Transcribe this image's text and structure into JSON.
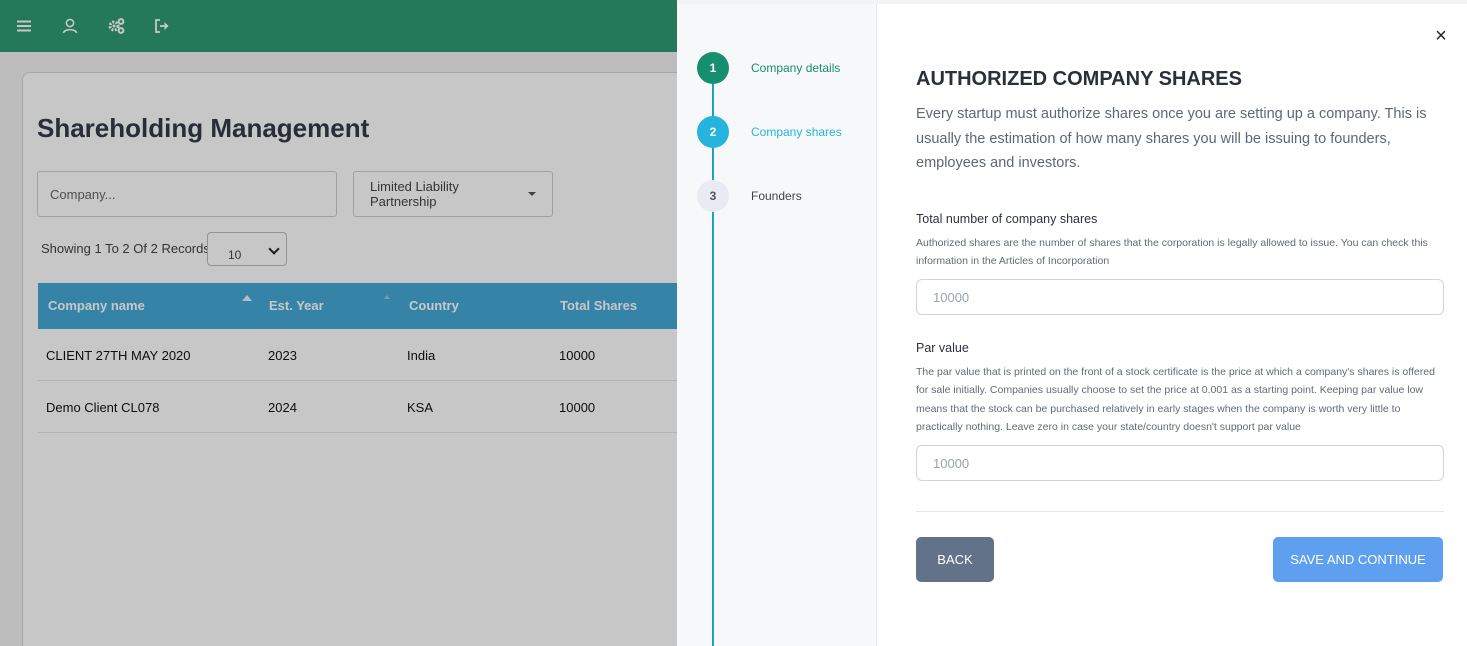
{
  "topbar": {
    "icons": [
      "menu-icon",
      "user-icon",
      "settings-icon",
      "logout-icon"
    ]
  },
  "page": {
    "title": "Shareholding Management",
    "search_placeholder": "Company...",
    "type_select_value": "Limited Liability Partnership",
    "showing_text": "Showing 1 To 2 Of 2 Records",
    "page_size": "10",
    "table": {
      "headers": [
        "Company name",
        "Est. Year",
        "Country",
        "Total Shares"
      ],
      "rows": [
        [
          "CLIENT 27TH MAY 2020",
          "2023",
          "India",
          "10000"
        ],
        [
          "Demo Client CL078",
          "2024",
          "KSA",
          "10000"
        ]
      ]
    }
  },
  "drawer": {
    "steps": [
      {
        "number": "1",
        "label": "Company details",
        "status": "completed"
      },
      {
        "number": "2",
        "label": "Company shares",
        "status": "active"
      },
      {
        "number": "3",
        "label": "Founders",
        "status": "pending"
      }
    ],
    "close_label": "×",
    "title": "AUTHORIZED COMPANY SHARES",
    "description": "Every startup must authorize shares once you are setting up a company. This is usually the estimation of how many shares you will be issuing to founders, employees and investors.",
    "total_shares": {
      "label": "Total number of company shares",
      "help": "Authorized shares are the number of shares that the corporation is legally allowed to issue. You can check this information in the Articles of Incorporation",
      "placeholder": "10000"
    },
    "par_value": {
      "label": "Par value",
      "help": "The par value that is printed on the front of a stock certificate is the price at which a company's shares is offered for sale initially. Companies usually choose to set the price at 0.001 as a starting point. Keeping par value low means that the stock can be purchased relatively in early stages when the company is worth very little to practically nothing. Leave zero in case your state/country doesn't support par value",
      "placeholder": "10000"
    },
    "back_label": "BACK",
    "save_label": "SAVE AND CONTINUE"
  },
  "colors": {
    "topbar": "#2d9c72",
    "table_header": "#45aad8",
    "step_completed": "#168f6e",
    "step_active": "#25b4dd",
    "back_button": "#627389",
    "save_button": "#5f9ff0"
  }
}
